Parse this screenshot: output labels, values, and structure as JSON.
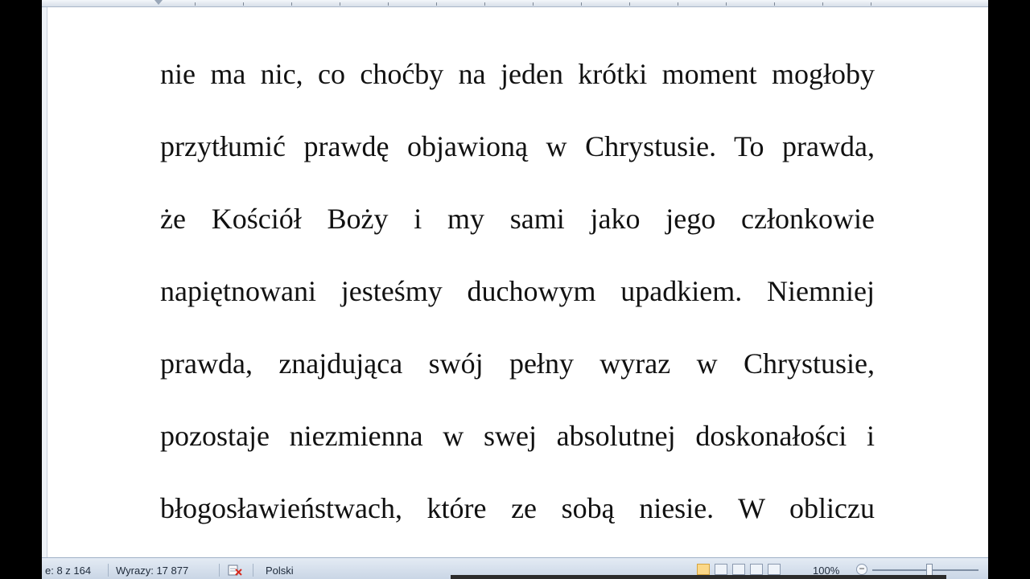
{
  "document": {
    "lines": [
      "nie ma nic, co choćby na jeden krótki moment mogłoby",
      "przytłumić prawdę objawioną w Chrystusie. To prawda,",
      "że Kościół Boży i my sami jako jego członkowie",
      "napiętnowani jesteśmy duchowym upadkiem. Niemniej",
      "prawda, znajdująca swój pełny wyraz w Chrystusie,",
      "pozostaje niezmienna w swej absolutnej doskonałości i",
      "błogosławieństwach, które ze sobą niesie. W obliczu"
    ]
  },
  "statusbar": {
    "page": "e: 8 z 164",
    "words": "Wyrazy: 17 877",
    "language": "Polski",
    "zoom": "100%",
    "zoom_level": 1.0
  },
  "colors": {
    "statusbar_bg": "#d3ddea",
    "page_bg": "#ffffff",
    "text": "#111111",
    "active_view": "#fbd889"
  },
  "icons": {
    "spell": "proofing-error-icon",
    "views": [
      "print-layout-icon",
      "full-screen-reading-icon",
      "web-layout-icon",
      "outline-icon",
      "draft-icon"
    ],
    "zoom_out": "zoom-out-icon"
  }
}
